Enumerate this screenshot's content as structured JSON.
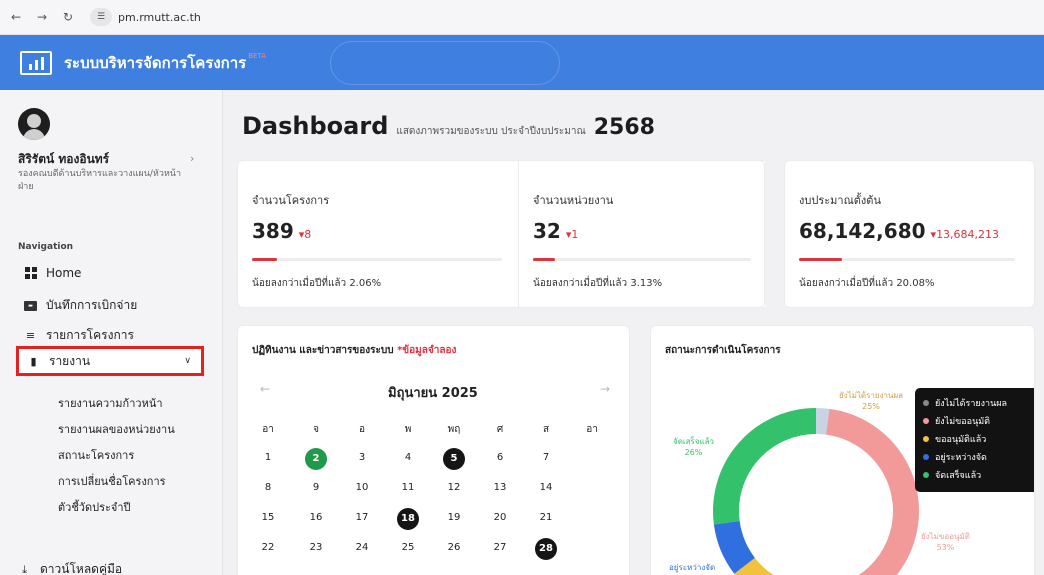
{
  "browser": {
    "url": "pm.rmutt.ac.th",
    "back_icon": "arrow-left",
    "forward_icon": "arrow-right",
    "reload_icon": "reload"
  },
  "header": {
    "title": "ระบบบริหารจัดการโครงการ",
    "tag": "BETA",
    "brand_color": "#3f7fe0"
  },
  "user": {
    "name": "สิริรัตน์ ทองอินทร์",
    "role": "รองคณบดีด้านบริหารและวางแผน/หัวหน้าฝ่าย"
  },
  "nav": {
    "heading": "Navigation",
    "items": [
      {
        "label": "Home",
        "icon": "grid-icon"
      },
      {
        "label": "บันทึกการเบิกจ่าย",
        "icon": "bill-icon"
      },
      {
        "label": "รายการโครงการ",
        "icon": "list-icon"
      }
    ],
    "report": {
      "label": "รายงาน",
      "icon": "document-icon"
    },
    "report_sub": [
      "รายงานความก้าวหน้า",
      "รายงานผลของหน่วยงาน",
      "สถานะโครงการ",
      "การเปลี่ยนชื่อโครงการ",
      "ตัวชี้วัดประจำปี"
    ],
    "download": {
      "label": "ดาวน์โหลดคู่มือ",
      "icon": "download-icon"
    }
  },
  "dashboard": {
    "title": "Dashboard",
    "subtitle": "แสดงภาพรวมของระบบ ประจำปีงบประมาณ",
    "year": "2568"
  },
  "stats": [
    {
      "label": "จำนวนโครงการ",
      "value": "389",
      "delta": "8",
      "note": "น้อยลงกว่าเมื่อปีที่แล้ว 2.06%",
      "progress_pct": 2.06
    },
    {
      "label": "จำนวนหน่วยงาน",
      "value": "32",
      "delta": "1",
      "note": "น้อยลงกว่าเมื่อปีที่แล้ว 3.13%",
      "progress_pct": 3.13
    },
    {
      "label": "งบประมาณตั้งต้น",
      "value": "68,142,680",
      "delta": "13,684,213",
      "note": "น้อยลงกว่าเมื่อปีที่แล้ว 20.08%",
      "progress_pct": 20.08
    }
  ],
  "calendar": {
    "title": "ปฏิทินงาน และข่าวสารของระบบ",
    "mock_note": "*ข้อมูลจำลอง",
    "month": "มิถุนายน 2025",
    "weekdays": [
      "อา",
      "จ",
      "อ",
      "พ",
      "พฤ",
      "ศ",
      "ส",
      "อา"
    ],
    "rows": [
      [
        "1",
        "2",
        "3",
        "4",
        "5",
        "6",
        "7"
      ],
      [
        "8",
        "9",
        "10",
        "11",
        "12",
        "13",
        "14"
      ],
      [
        "15",
        "16",
        "17",
        "18",
        "19",
        "20",
        "21"
      ],
      [
        "22",
        "23",
        "24",
        "25",
        "26",
        "27",
        "28"
      ]
    ],
    "highlight_green": [
      "2"
    ],
    "highlight_black": [
      "5",
      "18",
      "28"
    ]
  },
  "status_chart": {
    "title": "สถานะการดำเนินโครงการ",
    "legend": [
      {
        "label": "ยังไม่ได้รายงานผล",
        "color": "#8a8a8a"
      },
      {
        "label": "ยังไม่ขออนุมัติ",
        "color": "#f29a9a"
      },
      {
        "label": "ขออนุมัติแล้ว",
        "color": "#f2c23c"
      },
      {
        "label": "อยู่ระหว่างจัด",
        "color": "#2f6fe0"
      },
      {
        "label": "จัดเสร็จแล้ว",
        "color": "#33c26b"
      }
    ],
    "labels": {
      "not_reported": "ยังไม่ได้รายงานผล",
      "not_reported_pct": "25%",
      "completed": "จัดเสร็จแล้ว",
      "completed_pct": "26%",
      "not_approved": "ยังไม่ขออนุมัติ",
      "not_approved_pct": "53%",
      "in_progress": "อยู่ระหว่างจัด"
    }
  },
  "chart_data": {
    "type": "pie",
    "title": "สถานะการดำเนินโครงการ",
    "categories": [
      "ยังไม่ได้รายงานผล",
      "ยังไม่ขออนุมัติ",
      "ขออนุมัติแล้ว",
      "อยู่ระหว่างจัด",
      "จัดเสร็จแล้ว"
    ],
    "values": [
      2,
      53,
      7,
      8,
      26
    ],
    "colors": [
      "#c8d4e6",
      "#f29a9a",
      "#f2c23c",
      "#2f6fe0",
      "#33c26b"
    ],
    "legend": "top-right"
  }
}
